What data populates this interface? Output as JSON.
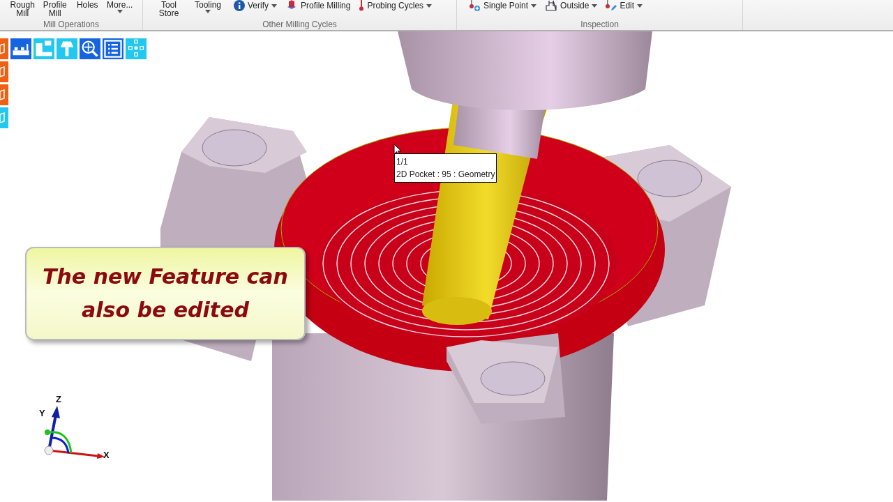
{
  "ribbon": {
    "groups": [
      {
        "label": "Mill Operations",
        "buttons": [
          {
            "kind": "large",
            "label": "Rough Mill",
            "dropdown": false
          },
          {
            "kind": "large",
            "label": "Profile Mill",
            "dropdown": false
          },
          {
            "kind": "large",
            "label": "Holes",
            "dropdown": false
          },
          {
            "kind": "large",
            "label": "More...",
            "dropdown": true
          }
        ]
      },
      {
        "label": "Other Milling Cycles",
        "buttons": [
          {
            "kind": "large",
            "label": "Tool Store",
            "dropdown": false
          },
          {
            "kind": "large",
            "label": "Tooling",
            "dropdown": true
          },
          {
            "kind": "small",
            "label": "Verify",
            "dropdown": true
          },
          {
            "kind": "small",
            "label": "Profile Milling",
            "dropdown": false
          },
          {
            "kind": "small",
            "label": "Probing Cycles",
            "dropdown": true
          }
        ]
      },
      {
        "label": "Inspection",
        "buttons": [
          {
            "kind": "small",
            "label": "Single Point",
            "dropdown": true
          },
          {
            "kind": "small",
            "label": "Outside",
            "dropdown": true
          },
          {
            "kind": "small",
            "label": "Edit",
            "dropdown": true
          }
        ]
      }
    ]
  },
  "tooltip": {
    "lines": [
      "1/1",
      "2D Pocket : 95 : Geometry"
    ]
  },
  "callout": {
    "text": "The new Feature can also be edited"
  },
  "triad": {
    "labels": [
      "Z",
      "Y",
      "X"
    ]
  }
}
